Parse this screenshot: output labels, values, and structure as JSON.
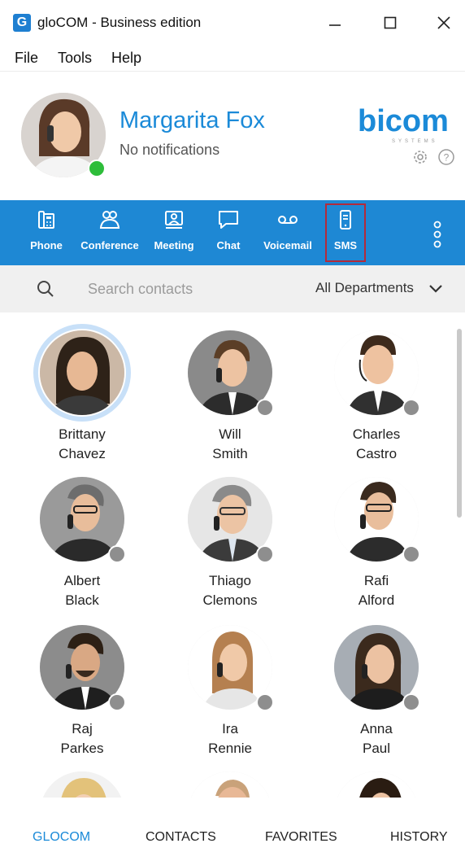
{
  "window": {
    "title": "gloCOM - Business edition",
    "logo_letter": "G",
    "controls": [
      "minimize-icon",
      "maximize-icon",
      "close-icon"
    ]
  },
  "menu": [
    "File",
    "Tools",
    "Help"
  ],
  "profile": {
    "name": "Margarita Fox",
    "status": "No notifications",
    "presence_color": "#2ebd3a",
    "brand": "bicom",
    "brand_sub": "SYSTEMS"
  },
  "toolbar": {
    "items": [
      {
        "label": "Phone",
        "icon": "phone-icon"
      },
      {
        "label": "Conference",
        "icon": "conference-icon"
      },
      {
        "label": "Meeting",
        "icon": "meeting-icon"
      },
      {
        "label": "Chat",
        "icon": "chat-icon"
      },
      {
        "label": "Voicemail",
        "icon": "voicemail-icon"
      },
      {
        "label": "SMS",
        "icon": "sms-icon",
        "selected": true
      }
    ],
    "more_icon": "more-vertical-icon"
  },
  "search": {
    "placeholder": "Search contacts",
    "department": "All Departments"
  },
  "contacts": [
    {
      "first": "Brittany",
      "last": "Chavez",
      "selected": true
    },
    {
      "first": "Will",
      "last": "Smith"
    },
    {
      "first": "Charles",
      "last": "Castro"
    },
    {
      "first": "Albert",
      "last": "Black"
    },
    {
      "first": "Thiago",
      "last": "Clemons"
    },
    {
      "first": "Rafi",
      "last": "Alford"
    },
    {
      "first": "Raj",
      "last": "Parkes"
    },
    {
      "first": "Ira",
      "last": "Rennie"
    },
    {
      "first": "Anna",
      "last": "Paul"
    }
  ],
  "tabs": {
    "glocom": "GLOCOM",
    "contacts": "CONTACTS",
    "favorites": "FAVORITES",
    "history": "HISTORY",
    "active": "GLOCOM"
  },
  "colors": {
    "accent": "#1e88d4",
    "brand_text": "#1b8ad8",
    "selection_outline": "#b42a3a",
    "offline_presence": "#8e8e8e"
  }
}
